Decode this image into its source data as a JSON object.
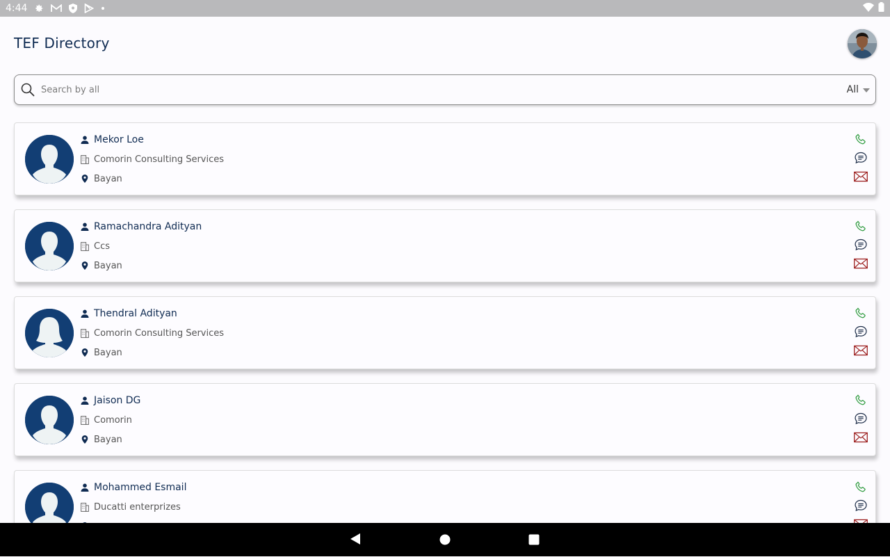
{
  "status_bar": {
    "time": "4:44",
    "left_icons": [
      "gear-icon",
      "gmail-icon",
      "shield-icon",
      "play-store-icon",
      "dot-icon"
    ],
    "right_icons": [
      "wifi-icon",
      "battery-icon"
    ]
  },
  "header": {
    "title": "TEF Directory"
  },
  "search": {
    "placeholder": "Search by all",
    "value": "",
    "filter_selected": "All"
  },
  "contacts": [
    {
      "name": "Mekor Loe",
      "company": "Comorin Consulting Services",
      "location": "Bayan",
      "avatar": "male"
    },
    {
      "name": "Ramachandra Adityan",
      "company": "Ccs",
      "location": "Bayan",
      "avatar": "male"
    },
    {
      "name": "Thendral Adityan",
      "company": "Comorin Consulting Services",
      "location": "Bayan",
      "avatar": "female"
    },
    {
      "name": "Jaison DG",
      "company": "Comorin",
      "location": "Bayan",
      "avatar": "male"
    },
    {
      "name": "Mohammed Esmail",
      "company": "Ducatti enterprizes",
      "location": "",
      "avatar": "male"
    }
  ],
  "colors": {
    "title": "#0f2b52",
    "avatar_bg": "#123e74",
    "phone": "#2e9b3e",
    "message": "#1f2f4a",
    "mail": "#9b1c1c"
  },
  "nav_bar": {
    "buttons": [
      "back-icon",
      "home-icon",
      "recents-icon"
    ]
  }
}
